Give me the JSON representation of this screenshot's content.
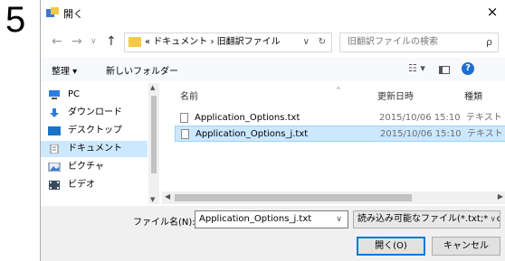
{
  "step_number": "5",
  "dialog": {
    "title": "開く",
    "close_glyph": "×"
  },
  "nav": {
    "back_glyph": "←",
    "forward_glyph": "→",
    "recent_glyph": "∨",
    "up_glyph": "↑"
  },
  "address": {
    "path": "« ドキュメント › 旧翻訳ファイル",
    "dropdown_glyph": "∨",
    "refresh_glyph": "↻"
  },
  "search": {
    "placeholder": "旧翻訳ファイルの検索",
    "icon_glyph": "ρ"
  },
  "toolbar": {
    "organize_label": "整理 ▾",
    "new_folder_label": "新しいフォルダー",
    "view_glyph": "☷ ▾",
    "help_glyph": "?"
  },
  "sidebar": {
    "items": [
      {
        "label": "PC",
        "icon": "pc-icon",
        "selected": false
      },
      {
        "label": "ダウンロード",
        "icon": "download-icon",
        "selected": false
      },
      {
        "label": "デスクトップ",
        "icon": "desktop-icon",
        "selected": false
      },
      {
        "label": "ドキュメント",
        "icon": "documents-icon",
        "selected": true
      },
      {
        "label": "ピクチャ",
        "icon": "pictures-icon",
        "selected": false
      },
      {
        "label": "ビデオ",
        "icon": "videos-icon",
        "selected": false
      }
    ]
  },
  "columns": {
    "name": "名前",
    "modified": "更新日時",
    "type": "種類"
  },
  "files": [
    {
      "name": "Application_Options.txt",
      "modified": "2015/10/06 15:10",
      "type": "テキスト ド",
      "selected": false
    },
    {
      "name": "Application_Options_j.txt",
      "modified": "2015/10/06 15:10",
      "type": "テキスト ド",
      "selected": true
    }
  ],
  "bottom": {
    "filename_label": "ファイル名(N):",
    "filename_value": "Application_Options_j.txt",
    "filetype_value": "読み込み可能なファイル(*.txt;*.do",
    "open_label": "開く(O)",
    "cancel_label": "キャンセル"
  },
  "colors": {
    "selection_bg": "#cce8ff",
    "selection_border": "#99d1ff",
    "toolbar_bg": "#f7f9fc",
    "accent": "#0078d7"
  }
}
